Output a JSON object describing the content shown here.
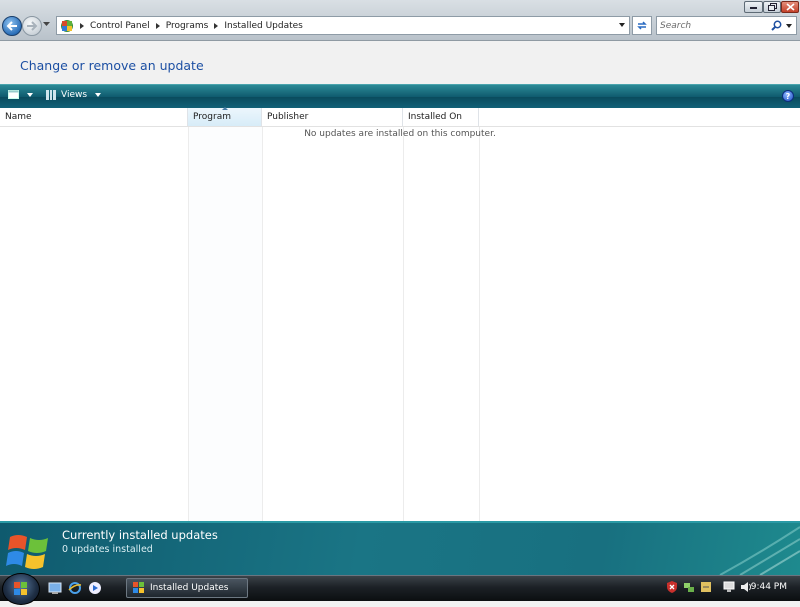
{
  "window": {
    "minimize_label": "Minimize",
    "maximize_label": "Maximize",
    "close_label": "Close"
  },
  "address_bar": {
    "breadcrumbs": [
      "Control Panel",
      "Programs",
      "Installed Updates"
    ]
  },
  "search": {
    "placeholder": "Search"
  },
  "header": {
    "title": "Change or remove an update"
  },
  "toolbar": {
    "views_label": "Views",
    "help_label": "?"
  },
  "list": {
    "columns": [
      "Name",
      "Program",
      "Publisher",
      "Installed On"
    ],
    "sorted_column": "Program",
    "empty_message": "No updates are installed on this computer."
  },
  "details": {
    "title": "Currently installed updates",
    "count_text": "0 updates installed"
  },
  "taskbar": {
    "active_task": "Installed Updates",
    "clock": "9:44 PM"
  },
  "colors": {
    "title_blue": "#1c4fa3",
    "toolbar_teal": "#0f5a6e",
    "details_teal": "#1a7585"
  }
}
